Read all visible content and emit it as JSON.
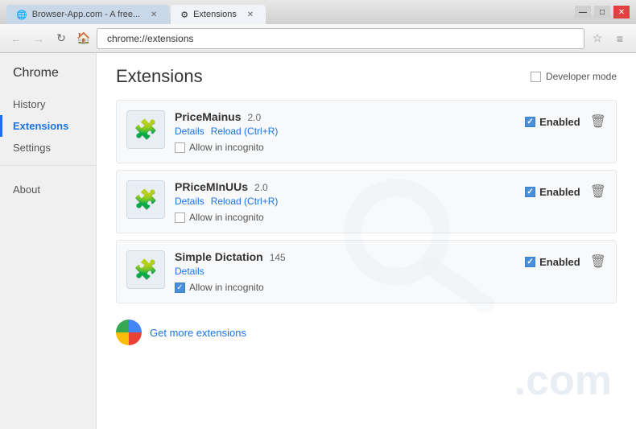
{
  "window": {
    "tabs": [
      {
        "id": "tab1",
        "label": "Browser-App.com - A free...",
        "favicon": "🌐",
        "active": false
      },
      {
        "id": "tab2",
        "label": "Extensions",
        "favicon": "⚙",
        "active": true
      }
    ],
    "controls": {
      "minimize": "—",
      "maximize": "□",
      "close": "✕"
    }
  },
  "navbar": {
    "back_disabled": true,
    "forward_disabled": true,
    "address": "chrome://extensions",
    "star_label": "☆",
    "menu_label": "≡"
  },
  "sidebar": {
    "title": "Chrome",
    "items": [
      {
        "id": "history",
        "label": "History",
        "active": false
      },
      {
        "id": "extensions",
        "label": "Extensions",
        "active": true
      },
      {
        "id": "settings",
        "label": "Settings",
        "active": false
      }
    ],
    "bottom_items": [
      {
        "id": "about",
        "label": "About",
        "active": false
      }
    ]
  },
  "main": {
    "title": "Extensions",
    "developer_mode_label": "Developer mode",
    "extensions": [
      {
        "id": "ext1",
        "name": "PriceMainus",
        "version": "2.0",
        "links": [
          {
            "label": "Details"
          },
          {
            "label": "Reload (Ctrl+R)"
          }
        ],
        "incognito_label": "Allow in incognito",
        "incognito_checked": false,
        "enabled": true,
        "enabled_label": "Enabled"
      },
      {
        "id": "ext2",
        "name": "PRiceMInUUs",
        "version": "2.0",
        "links": [
          {
            "label": "Details"
          },
          {
            "label": "Reload (Ctrl+R)"
          }
        ],
        "incognito_label": "Allow in incognito",
        "incognito_checked": false,
        "enabled": true,
        "enabled_label": "Enabled"
      },
      {
        "id": "ext3",
        "name": "Simple Dictation",
        "version": "145",
        "links": [
          {
            "label": "Details"
          }
        ],
        "incognito_label": "Allow in incognito",
        "incognito_checked": true,
        "enabled": true,
        "enabled_label": "Enabled"
      }
    ],
    "get_more_label": "Get more extensions"
  }
}
